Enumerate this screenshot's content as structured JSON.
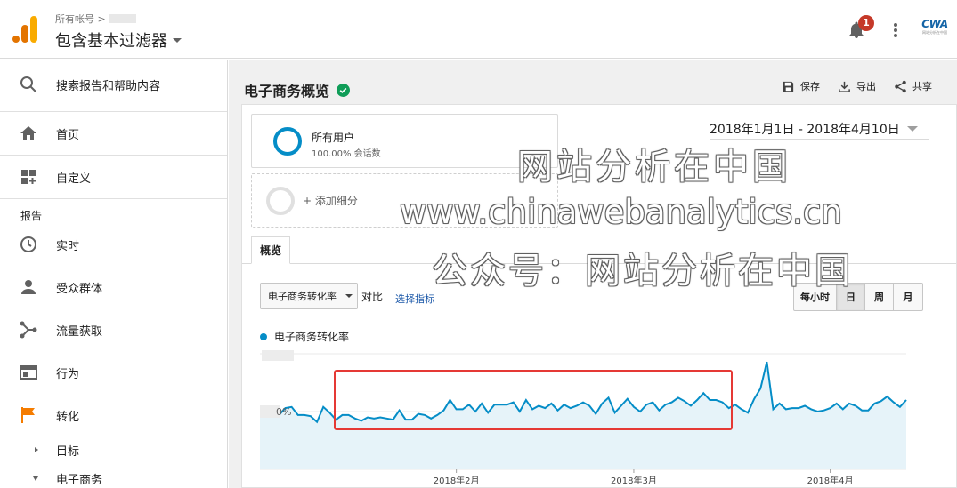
{
  "header": {
    "breadcrumb_text": "所有帐号 >",
    "view_title": "包含基本过滤器",
    "notification_count": "1",
    "brand_text": "CWA",
    "brand_subtext": "网站分析在中国"
  },
  "sidebar": {
    "search_label": "搜索报告和帮助内容",
    "home_label": "首页",
    "customize_label": "自定义",
    "reports_section": "报告",
    "items": [
      {
        "label": "实时",
        "icon": "clock-icon"
      },
      {
        "label": "受众群体",
        "icon": "person-icon"
      },
      {
        "label": "流量获取",
        "icon": "acquisition-icon"
      },
      {
        "label": "行为",
        "icon": "behavior-icon"
      },
      {
        "label": "转化",
        "icon": "flag-icon"
      }
    ],
    "sub_goals": "目标",
    "sub_ecommerce": "电子商务"
  },
  "report": {
    "title": "电子商务概览",
    "save": "保存",
    "export": "导出",
    "share": "共享",
    "date_range": "2018年1月1日 - 2018年4月10日",
    "segment_name": "所有用户",
    "segment_pct": "100.00% 会话数",
    "add_segment": "+ 添加细分",
    "tab_overview": "概览",
    "metric_select": "电子商务转化率",
    "vs_label": "对比",
    "select_metric": "选择指标",
    "granularity": [
      "每小时",
      "日",
      "周",
      "月"
    ],
    "granularity_active": "日"
  },
  "colors": {
    "line": "#058dc7",
    "area": "#e6f3f9",
    "highlight_box": "#e53935",
    "flag": "#f57c00"
  },
  "chart_data": {
    "type": "area",
    "legend": "电子商务转化率",
    "y_tick_label": "0%",
    "x_tick_labels": [
      "2018年2月",
      "2018年3月",
      "2018年4月"
    ],
    "x_tick_positions_day_index": [
      31,
      59,
      90
    ],
    "values": [
      0.5,
      0.48,
      0.54,
      0.47,
      0.53,
      0.54,
      0.47,
      0.47,
      0.46,
      0.41,
      0.54,
      0.49,
      0.43,
      0.47,
      0.47,
      0.44,
      0.42,
      0.45,
      0.44,
      0.45,
      0.44,
      0.43,
      0.51,
      0.43,
      0.43,
      0.48,
      0.47,
      0.44,
      0.47,
      0.51,
      0.6,
      0.52,
      0.52,
      0.56,
      0.5,
      0.57,
      0.49,
      0.56,
      0.56,
      0.56,
      0.58,
      0.5,
      0.6,
      0.52,
      0.55,
      0.53,
      0.57,
      0.51,
      0.56,
      0.53,
      0.55,
      0.58,
      0.55,
      0.48,
      0.57,
      0.62,
      0.49,
      0.55,
      0.61,
      0.54,
      0.5,
      0.56,
      0.58,
      0.51,
      0.56,
      0.58,
      0.62,
      0.59,
      0.55,
      0.6,
      0.66,
      0.6,
      0.6,
      0.58,
      0.53,
      0.56,
      0.52,
      0.49,
      0.61,
      0.7,
      0.93,
      0.52,
      0.57,
      0.52,
      0.53,
      0.53,
      0.55,
      0.52,
      0.5,
      0.51,
      0.53,
      0.57,
      0.52,
      0.57,
      0.55,
      0.51,
      0.51,
      0.57,
      0.59,
      0.63,
      0.58,
      0.54,
      0.6
    ]
  },
  "watermarks": {
    "line1": "网站分析在中国",
    "line2": "www.chinawebanalytics.cn",
    "line3": "公众号：网站分析在中国"
  }
}
